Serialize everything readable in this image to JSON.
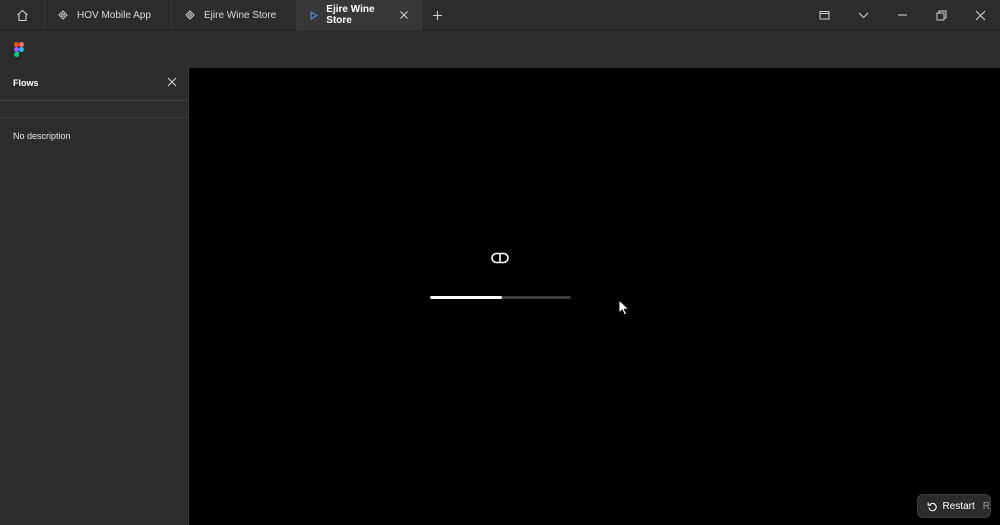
{
  "tabs": [
    {
      "label": "HOV Mobile App",
      "icon": "figma-file-icon"
    },
    {
      "label": "Ejire Wine Store",
      "icon": "figma-file-icon"
    },
    {
      "label": "Ejire Wine Store",
      "icon": "play-icon",
      "active": true
    }
  ],
  "sidebar": {
    "title": "Flows",
    "description": "No description"
  },
  "prototype": {
    "loading_progress": 0.51
  },
  "restart": {
    "label": "Restart",
    "shortcut": "R"
  },
  "colors": {
    "chrome": "#2c2c2c",
    "canvas": "#000000",
    "accent": "#4da3ff"
  }
}
